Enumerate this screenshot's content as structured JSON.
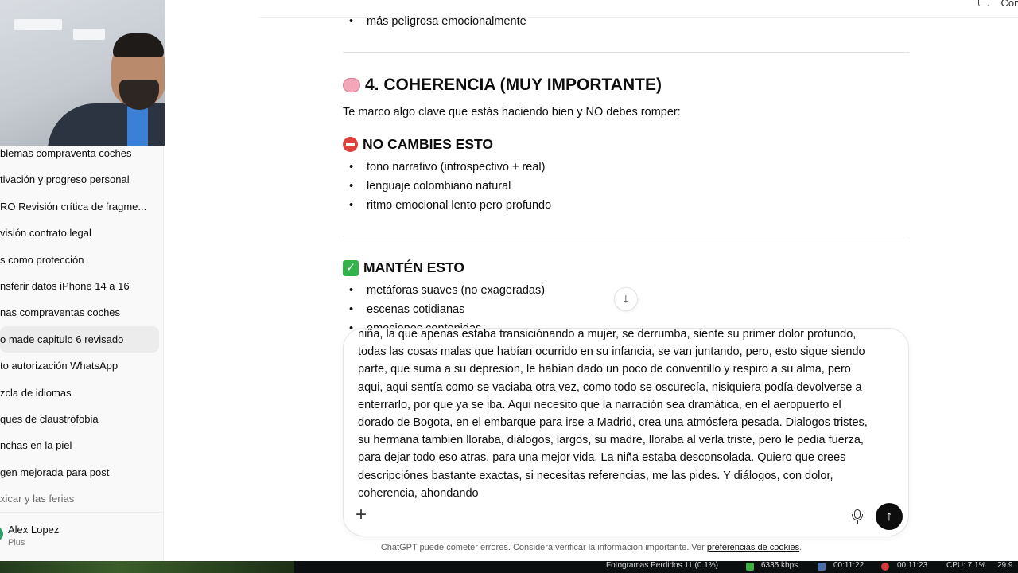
{
  "sidebar": {
    "chats": [
      {
        "label": "blemas compraventa coches"
      },
      {
        "label": "tivación y progreso personal"
      },
      {
        "label": "RO Revisión crítica de fragme..."
      },
      {
        "label": "visión contrato legal"
      },
      {
        "label": "s como protección"
      },
      {
        "label": "nsferir datos iPhone 14 a 16"
      },
      {
        "label": "nas compraventas coches"
      },
      {
        "label": "o made capitulo 6 revisado"
      },
      {
        "label": "to autorización WhatsApp"
      },
      {
        "label": "zcla de idiomas"
      },
      {
        "label": "ques de claustrofobia"
      },
      {
        "label": "nchas en la piel"
      },
      {
        "label": "gen mejorada para post"
      },
      {
        "label": "xicar y las ferias"
      }
    ],
    "user": {
      "name": "Alex Lopez",
      "plan": "Plus"
    }
  },
  "topbar": {
    "label": "Com"
  },
  "conversation": {
    "top_bullet": "más peligrosa emocionalmente",
    "section4_title": "4. COHERENCIA (MUY IMPORTANTE)",
    "section4_intro": "Te marco algo clave que estás haciendo bien y NO debes romper:",
    "no_change_title": "NO CAMBIES ESTO",
    "no_change_items": [
      "tono narrativo (introspectivo + real)",
      "lenguaje colombiano natural",
      "ritmo emocional lento pero profundo"
    ],
    "keep_title": "MANTÉN ESTO",
    "keep_items": [
      "metáforas suaves (no exageradas)",
      "escenas cotidianas",
      "emociones contenidas"
    ]
  },
  "composer": {
    "text": "niña, la que apenas estaba transiciónando a mujer, se derrumba, siente su primer dolor profundo,\ntodas las cosas malas que habían ocurrido en su infancia, se van juntando, pero, esto sigue siendo\nparte, que suma a su depresion, le habían dado un poco de conventillo y respiro a su alma, pero\naqui, aqui sentía como se vaciaba otra vez, como todo se oscurecía, nisiquiera podía devolverse a\nenterrarlo, por que ya se iba. Aqui necesito que la narración sea dramática, en el aeropuerto el\ndorado de Bogota, en el embarque para irse a Madrid, crea una atmósfera pesada. Dialogos tristes,\nsu hermana tambien lloraba, diálogos, largos, su madre, lloraba al verla triste, pero le pedia fuerza,\npara dejar todo eso atras, para una mejor vida. La niña estaba desconsolada. Quiero que crees\ndescripciónes bastante exactas, si necesitas referencias, me las pides. Y diálogos, con dolor,\ncoherencia, ahondando",
    "plus_glyph": "+",
    "send_glyph": "↑"
  },
  "scroll_down_glyph": "↓",
  "footer": {
    "text": "ChatGPT puede cometer errores. Considera verificar la información importante. Ver ",
    "link": "preferencias de cookies",
    "suffix": "."
  },
  "taskbar": {
    "items": [
      {
        "label": "Fotogramas Perdidos 11 (0.1%)"
      },
      {
        "label": "6335 kbps"
      },
      {
        "label": "00:11:22"
      },
      {
        "label": "00:11:23"
      },
      {
        "label": "CPU: 7.1%"
      },
      {
        "label": "29.9"
      }
    ]
  },
  "colors": {
    "accent_send": "#0d0d0d",
    "no_entry": "#e0413b",
    "check": "#33b249",
    "sidebar_bg": "#f9f9f9"
  }
}
